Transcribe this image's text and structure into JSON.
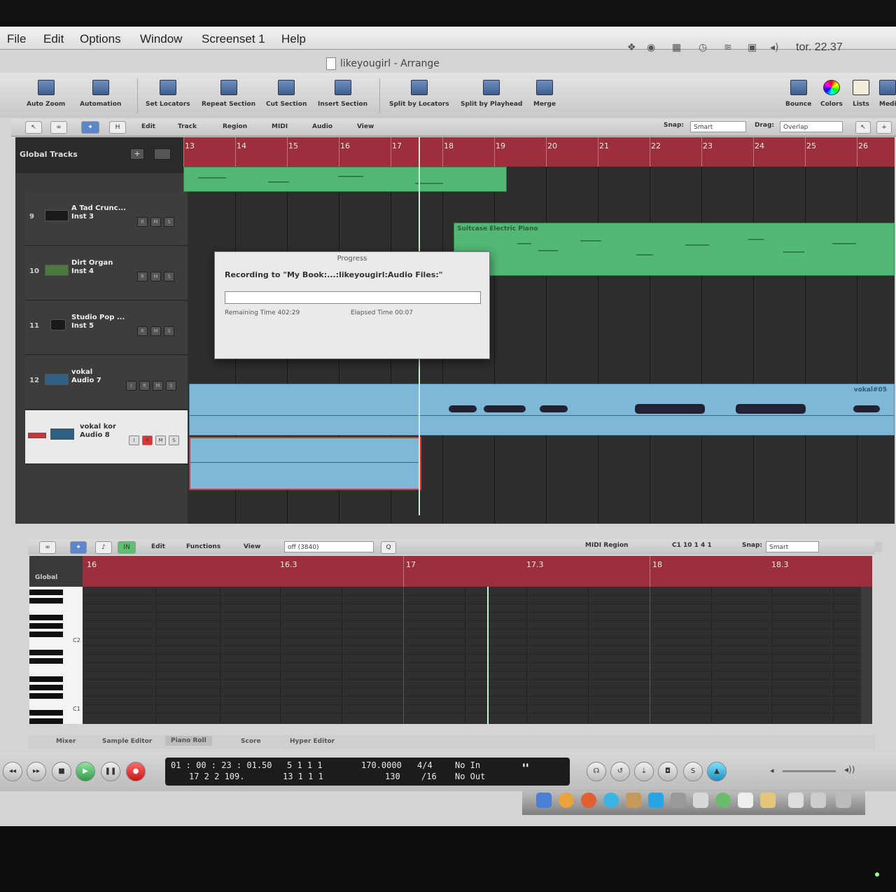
{
  "menubar": {
    "items": [
      "File",
      "Edit",
      "Options",
      "Window",
      "Screenset 1",
      "Help"
    ],
    "clock": "tor. 22.37",
    "status_icons": [
      "dropbox-icon",
      "quicktime-icon",
      "bluetooth-icon",
      "time-machine-icon",
      "wifi-icon",
      "display-icon",
      "volume-icon"
    ]
  },
  "window": {
    "title": "likeyougirl - Arrange"
  },
  "toolbar": {
    "buttons": [
      "Auto Zoom",
      "Automation",
      "Set Locators",
      "Repeat Section",
      "Cut Section",
      "Insert Section",
      "Split by Locators",
      "Split by Playhead",
      "Merge",
      "Bounce",
      "Colors",
      "Lists",
      "Medi"
    ]
  },
  "arrange_strip": {
    "menus": [
      "Edit",
      "Track",
      "Region",
      "MIDI",
      "Audio",
      "View"
    ],
    "snap_label": "Snap:",
    "snap_value": "Smart",
    "drag_label": "Drag:",
    "drag_value": "Overlap"
  },
  "global_tracks": {
    "label": "Global Tracks"
  },
  "ruler": {
    "bars": [
      "13",
      "14",
      "15",
      "16",
      "17",
      "18",
      "19",
      "20",
      "21",
      "22",
      "23",
      "24",
      "25",
      "26"
    ]
  },
  "tracks": [
    {
      "number": "9",
      "name": "A Tad Crunc...",
      "sub": "Inst 3"
    },
    {
      "number": "10",
      "name": "Dirt Organ",
      "sub": "Inst 4"
    },
    {
      "number": "11",
      "name": "Studio Pop ...",
      "sub": "Inst 5"
    },
    {
      "number": "12",
      "name": "vokal",
      "sub": "Audio 7"
    },
    {
      "number": "",
      "name": "vokal kor",
      "sub": "Audio 8"
    }
  ],
  "regions": {
    "electric_piano": "Suitcase Electric Piano",
    "vokal": "vokal#05"
  },
  "dialog": {
    "title": "Progress",
    "message": "Recording to \"My Book:...:likeyougirl:Audio Files:\"",
    "remaining": "Remaining Time 402:29",
    "elapsed": "Elapsed Time 00:07"
  },
  "editor_strip": {
    "menus": [
      "Edit",
      "Functions",
      "View"
    ],
    "quantize": "off (3840)",
    "region_type": "MIDI Region",
    "position": "C1  10 1 4 1",
    "snap_label": "Snap:",
    "snap_value": "Smart"
  },
  "piano_roll": {
    "global": "Global",
    "ruler_labels": [
      "16",
      "16.3",
      "17",
      "17.3",
      "18",
      "18.3"
    ],
    "key_labels": [
      "C2",
      "C1"
    ]
  },
  "tabs": [
    "Mixer",
    "Sample Editor",
    "Piano Roll",
    "Score",
    "Hyper Editor"
  ],
  "active_tab": "Piano Roll",
  "transport": {
    "smpte": "01 : 00 : 23 : 01.50",
    "bbt": "17   2   2  109.",
    "end_top": "5   1   1   1",
    "end_bottom": "13   1   1   1",
    "tempo": "170.0000",
    "tempo_sub": "130",
    "sig": "4/4",
    "div": "/16",
    "in": "No In",
    "out": "No Out"
  },
  "colors": {
    "ruler": "#9b2f3c",
    "midi_region": "#53b876",
    "audio_region": "#7fb8d6",
    "record": "#d33"
  }
}
